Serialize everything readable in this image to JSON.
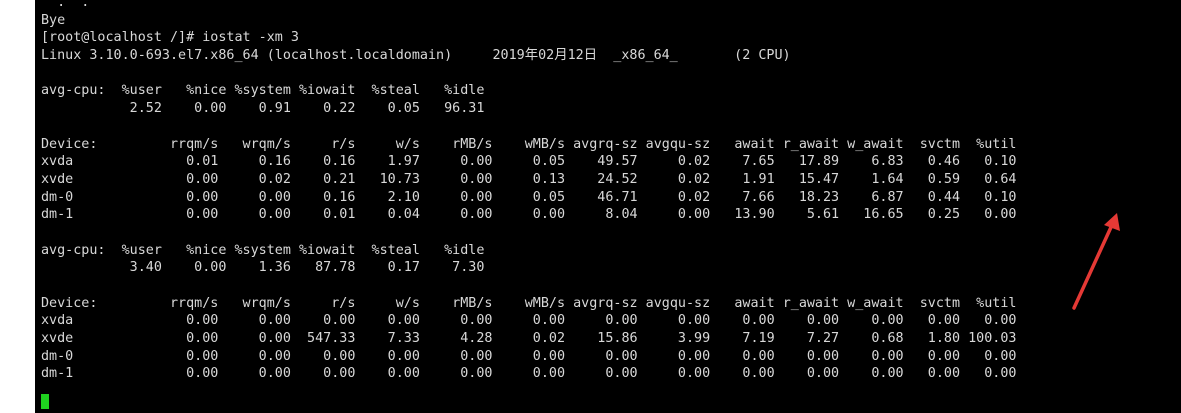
{
  "terminal": {
    "lines": [
      "  .  .  ",
      "Bye",
      "[root@localhost /]# iostat -xm 3",
      "Linux 3.10.0-693.el7.x86_64 (localhost.localdomain)     2019年02月12日  _x86_64_       (2 CPU)",
      "",
      "avg-cpu:  %user   %nice %system %iowait  %steal   %idle",
      "           2.52    0.00    0.91    0.22    0.05   96.31",
      "",
      "Device:         rrqm/s   wrqm/s     r/s     w/s    rMB/s    wMB/s avgrq-sz avgqu-sz   await r_await w_await  svctm  %util",
      "xvda              0.01     0.16    0.16    1.97     0.00     0.05    49.57     0.02    7.65   17.89    6.83   0.46   0.10",
      "xvde              0.00     0.02    0.21   10.73     0.00     0.13    24.52     0.02    1.91   15.47    1.64   0.59   0.64",
      "dm-0              0.00     0.00    0.16    2.10     0.00     0.05    46.71     0.02    7.66   18.23    6.87   0.44   0.10",
      "dm-1              0.00     0.00    0.01    0.04     0.00     0.00     8.04     0.00   13.90    5.61   16.65   0.25   0.00",
      "",
      "avg-cpu:  %user   %nice %system %iowait  %steal   %idle",
      "           3.40    0.00    1.36   87.78    0.17    7.30",
      "",
      "Device:         rrqm/s   wrqm/s     r/s     w/s    rMB/s    wMB/s avgrq-sz avgqu-sz   await r_await w_await  svctm  %util",
      "xvda              0.00     0.00    0.00    0.00     0.00     0.00     0.00     0.00    0.00    0.00    0.00   0.00   0.00",
      "xvde              0.00     0.00  547.33    7.33     4.28     0.02    15.86     3.99    7.19    7.27    0.68   1.80 100.03",
      "dm-0              0.00     0.00    0.00    0.00     0.00     0.00     0.00     0.00    0.00    0.00    0.00   0.00   0.00",
      "dm-1              0.00     0.00    0.00    0.00     0.00     0.00     0.00     0.00    0.00    0.00    0.00   0.00   0.00",
      ""
    ]
  },
  "colors": {
    "background": "#000000",
    "text": "#d8d8d8",
    "cursor": "#1fd11f",
    "annotation_arrow": "#e53935"
  },
  "annotation": {
    "icon": "red-arrow-icon"
  }
}
